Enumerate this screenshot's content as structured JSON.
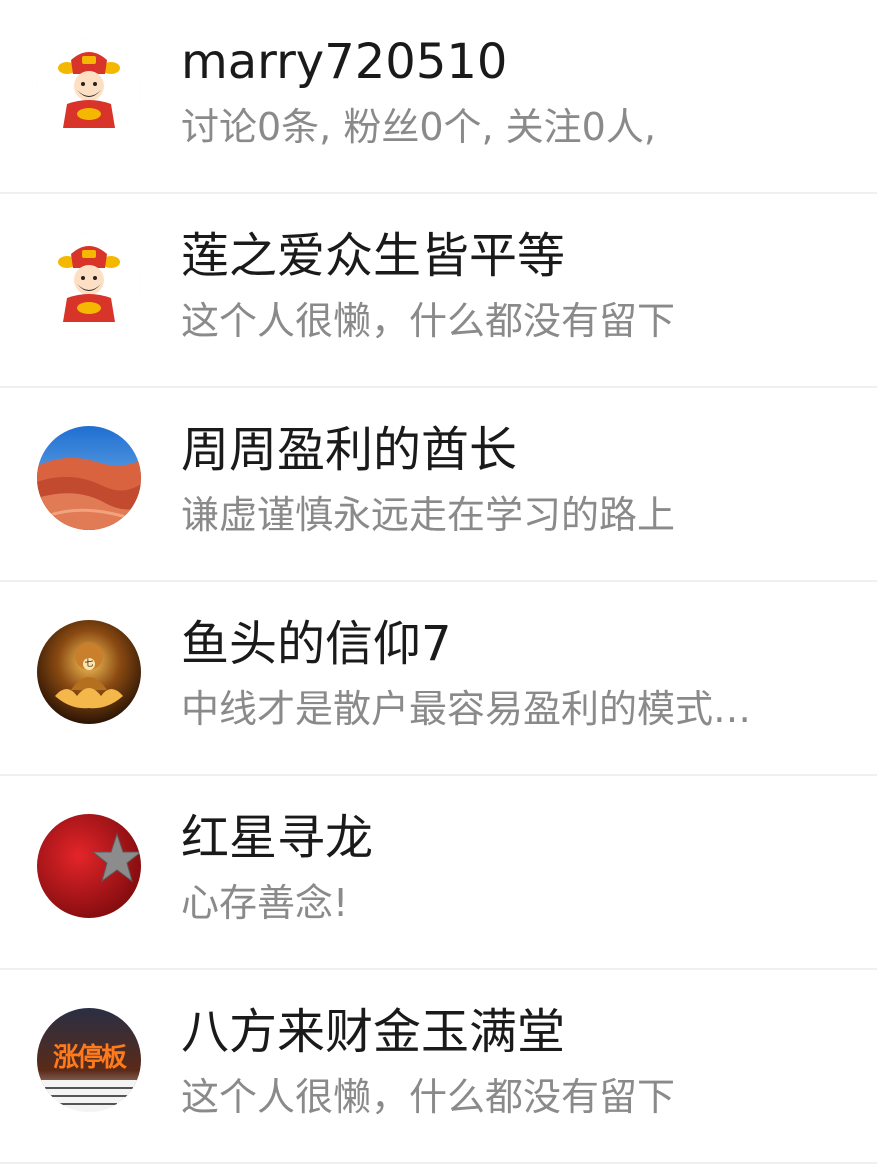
{
  "users": [
    {
      "name": "marry720510",
      "bio": "讨论0条, 粉丝0个, 关注0人,",
      "avatar_icon": "god-of-wealth-avatar"
    },
    {
      "name": "莲之爱众生皆平等",
      "bio": "这个人很懒，什么都没有留下",
      "avatar_icon": "god-of-wealth-avatar"
    },
    {
      "name": "周周盈利的酋长",
      "bio": "谦虚谨慎永远走在学习的路上",
      "avatar_icon": "red-canyon-photo-avatar"
    },
    {
      "name": "鱼头的信仰7",
      "bio": "中线才是散户最容易盈利的模式…",
      "avatar_icon": "golden-buddha-avatar",
      "avatar_text": "七"
    },
    {
      "name": "红星寻龙",
      "bio": "心存善念!",
      "avatar_icon": "red-star-avatar"
    },
    {
      "name": "八方来财金玉满堂",
      "bio": "这个人很懒，什么都没有留下",
      "avatar_icon": "limit-up-board-avatar",
      "avatar_text": "涨停板"
    }
  ]
}
